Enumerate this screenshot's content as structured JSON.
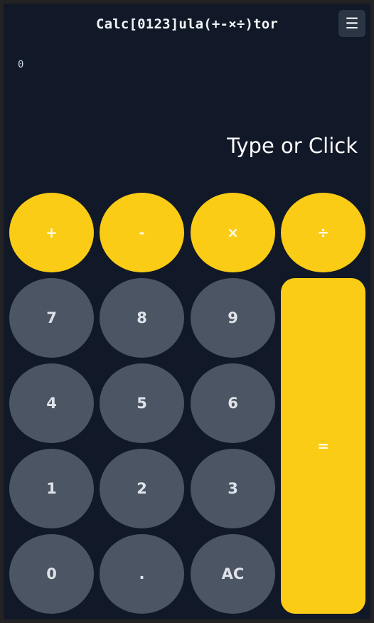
{
  "header": {
    "title": "Calc[0123]ula(+-×÷)tor",
    "menu_icon": "☰"
  },
  "expression": "0",
  "display": "Type or Click",
  "colors": {
    "background": "#111827",
    "operator": "#facc15",
    "number": "#4b5563"
  },
  "keys": {
    "plus": "+",
    "minus": "-",
    "multiply": "×",
    "divide": "÷",
    "seven": "7",
    "eight": "8",
    "nine": "9",
    "four": "4",
    "five": "5",
    "six": "6",
    "one": "1",
    "two": "2",
    "three": "3",
    "zero": "0",
    "decimal": ".",
    "clear": "AC",
    "equals": "="
  }
}
